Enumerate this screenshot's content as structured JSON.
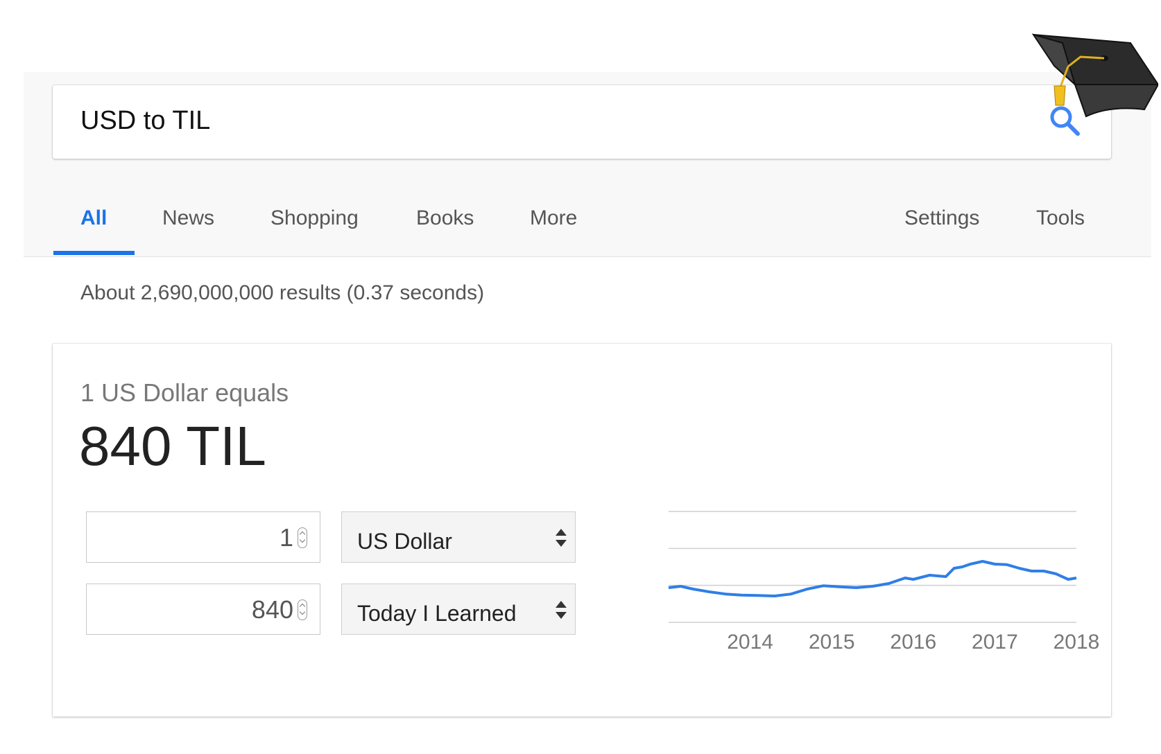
{
  "search": {
    "query": "USD to TIL"
  },
  "tabs": [
    {
      "label": "All",
      "active": true
    },
    {
      "label": "News"
    },
    {
      "label": "Shopping"
    },
    {
      "label": "Books"
    },
    {
      "label": "More"
    },
    {
      "label": "Settings"
    },
    {
      "label": "Tools"
    }
  ],
  "result_stats": "About 2,690,000,000 results (0.37 seconds)",
  "converter": {
    "equals_label": "1 US Dollar equals",
    "result": "840 TIL",
    "from_amount": "1",
    "from_currency": "US Dollar",
    "to_amount": "840",
    "to_currency": "Today I Learned"
  },
  "colors": {
    "accent": "#1a73e8",
    "chart_line": "#2f7ee6"
  },
  "icons": {
    "search": "search-icon",
    "decoration": "graduation-cap-icon"
  },
  "chart_data": {
    "type": "line",
    "title": "",
    "xlabel": "",
    "ylabel": "",
    "x_tick_labels": [
      "2014",
      "2015",
      "2016",
      "2017",
      "2018"
    ],
    "xlim": [
      2013.3,
      2018.3
    ],
    "ylim": [
      0,
      4
    ],
    "grid": true,
    "series": [
      {
        "x": [
          2013.3,
          2013.45,
          2013.6,
          2013.8,
          2014.0,
          2014.2,
          2014.4,
          2014.6,
          2014.8,
          2015.0,
          2015.2,
          2015.4,
          2015.6,
          2015.8,
          2016.0,
          2016.2,
          2016.3,
          2016.5,
          2016.7,
          2016.8,
          2016.9,
          2017.0,
          2017.15,
          2017.3,
          2017.45,
          2017.6,
          2017.75,
          2017.9,
          2018.05,
          2018.2,
          2018.3
        ],
        "y": [
          1.25,
          1.3,
          1.2,
          1.1,
          1.02,
          0.98,
          0.97,
          0.95,
          1.02,
          1.2,
          1.32,
          1.28,
          1.25,
          1.3,
          1.4,
          1.6,
          1.55,
          1.7,
          1.65,
          1.95,
          2.0,
          2.1,
          2.2,
          2.1,
          2.08,
          1.95,
          1.85,
          1.85,
          1.75,
          1.55,
          1.6
        ]
      }
    ]
  }
}
